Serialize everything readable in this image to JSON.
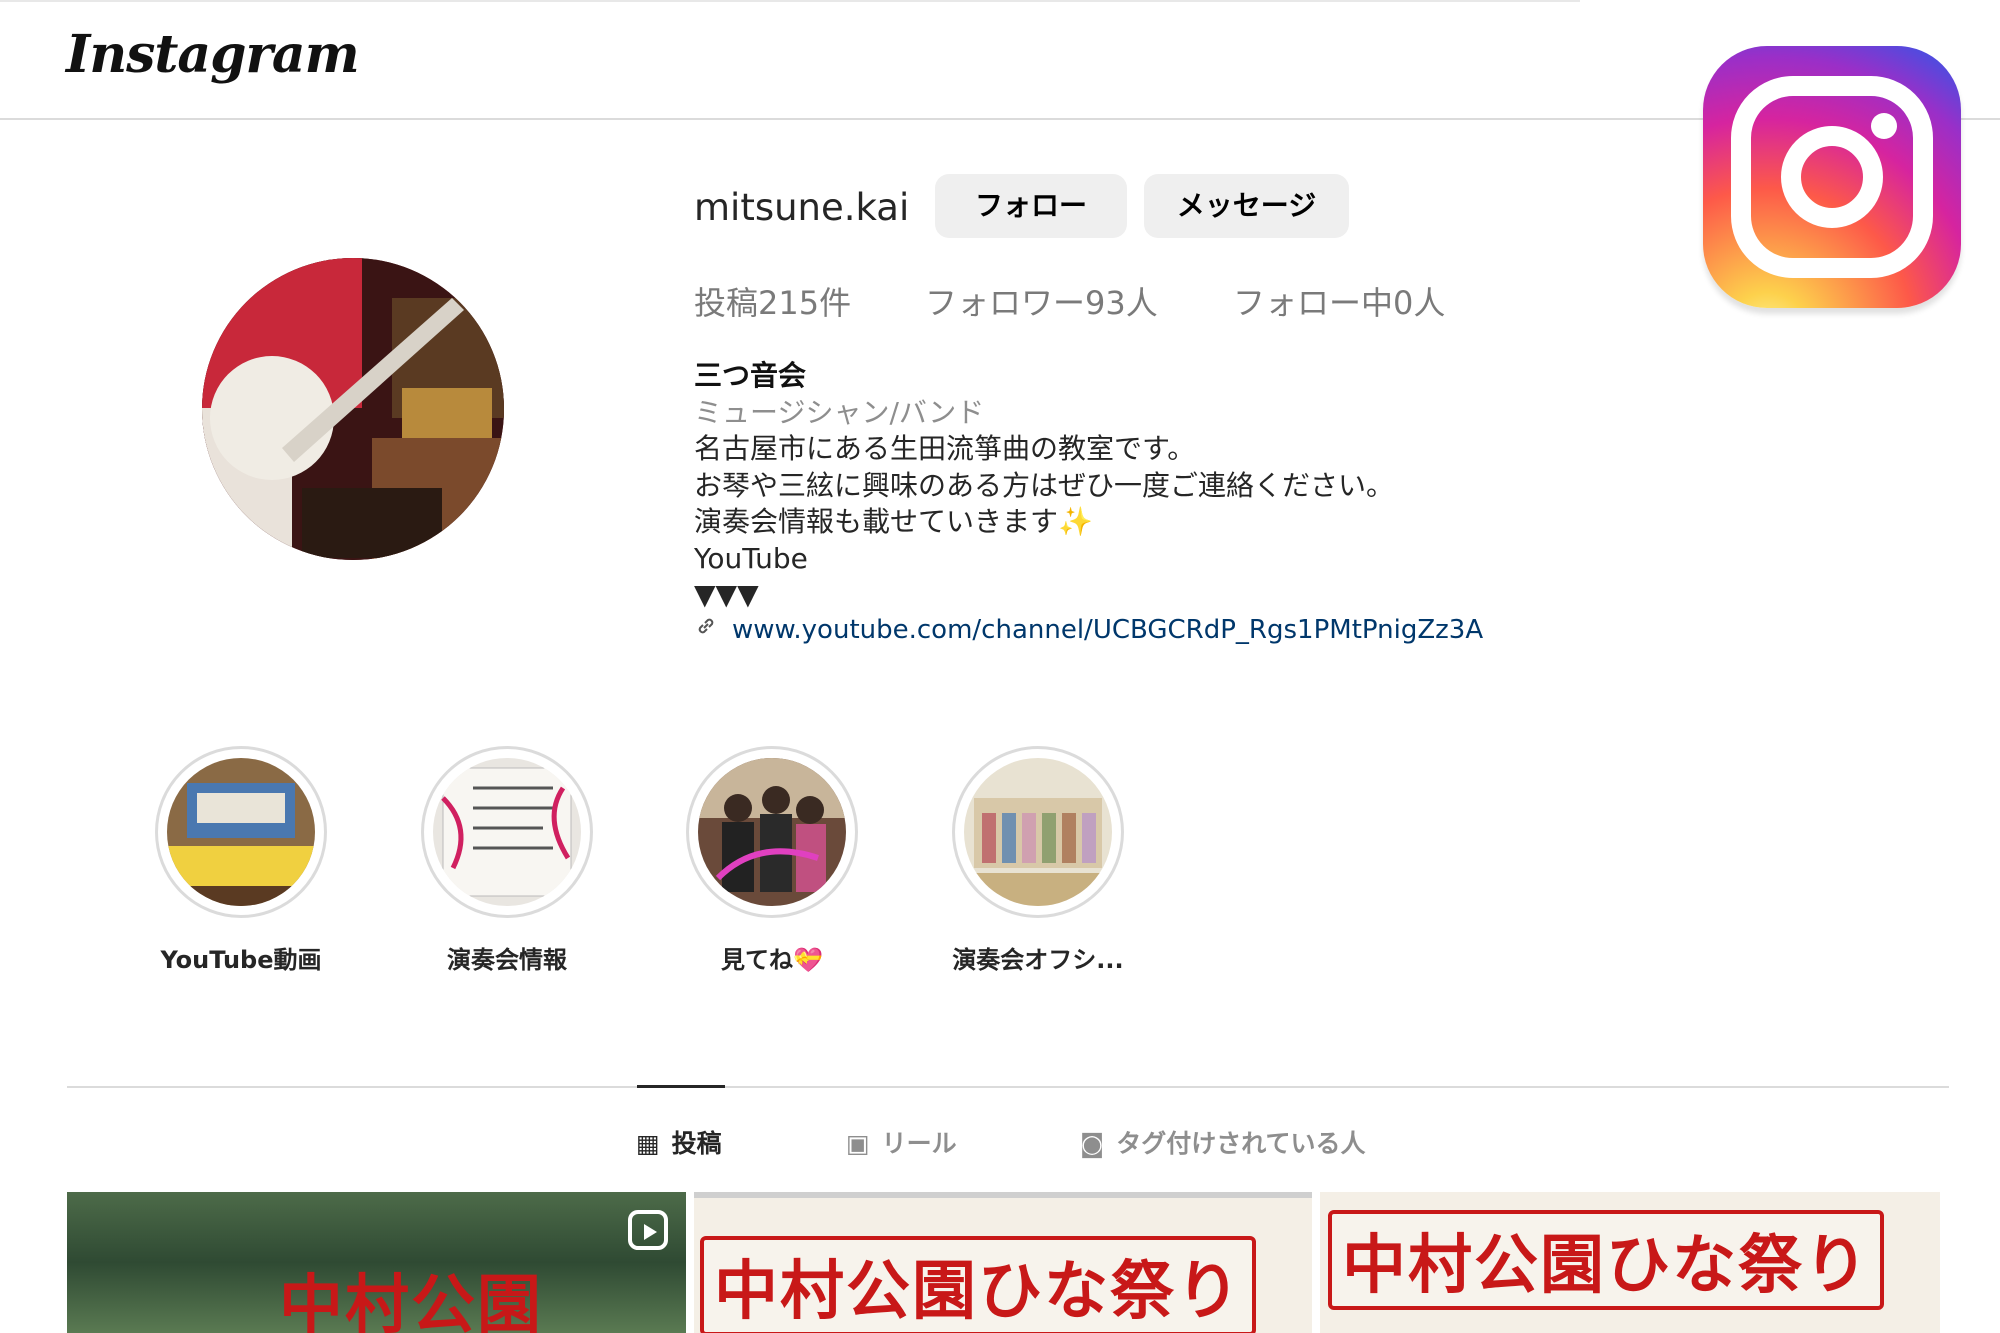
{
  "app": {
    "logo": "Instagram"
  },
  "badge": {
    "icon": "instagram-logo-icon"
  },
  "profile": {
    "username": "mitsune.kai",
    "follow_label": "フォロー",
    "message_label": "メッセージ",
    "stats": {
      "posts": "投稿215件",
      "followers": "フォロワー93人",
      "following": "フォロー中0人"
    },
    "bio": {
      "name": "三つ音会",
      "category": "ミュージシャン/バンド",
      "lines": [
        "名古屋市にある生田流箏曲の教室です。",
        "お琴や三絃に興味のある方はぜひ一度ご連絡ください。",
        "演奏会情報も載せていきます✨",
        "YouTube",
        "▼▼▼"
      ]
    },
    "link": "www.youtube.com/channel/UCBGCRdP_Rgs1PMtPnigZz3A"
  },
  "highlights": [
    {
      "label": "YouTube動画"
    },
    {
      "label": "演奏会情報"
    },
    {
      "label": "見てね💝"
    },
    {
      "label": "演奏会オフシ..."
    }
  ],
  "tabs": [
    {
      "label": "投稿",
      "icon": "grid-icon"
    },
    {
      "label": "リール",
      "icon": "reels-icon"
    },
    {
      "label": "タグ付けされている人",
      "icon": "tagged-icon"
    }
  ],
  "posts": [
    {
      "title": "中村公園"
    },
    {
      "title": "中村公園ひな祭り"
    },
    {
      "title": "中村公園ひな祭り"
    }
  ],
  "colors": {
    "link": "#00376b",
    "button_bg": "#efefef",
    "post_title": "#c81818"
  }
}
